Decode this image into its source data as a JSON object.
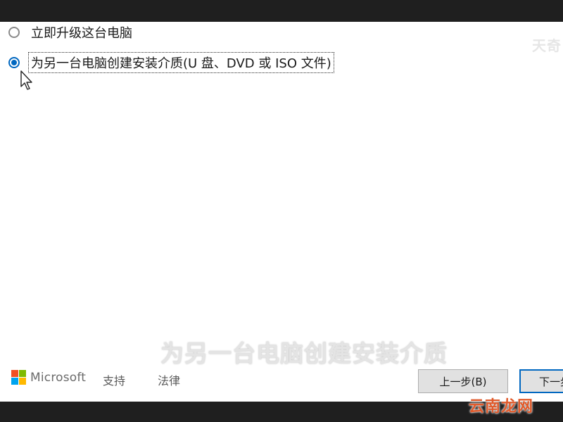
{
  "options": [
    {
      "label": "立即升级这台电脑",
      "selected": false
    },
    {
      "label": "为另一台电脑创建安装介质(U 盘、DVD 或 ISO 文件)",
      "selected": true
    }
  ],
  "footer": {
    "brand": "Microsoft",
    "links": {
      "support": "支持",
      "legal": "法律"
    },
    "buttons": {
      "back": "上一步(B)",
      "next": "下一步(N)"
    }
  },
  "overlays": {
    "subtitle": "为另一台电脑创建安装介质",
    "top_right_watermark": "天奇",
    "corner_watermark": "云南龙网"
  },
  "colors": {
    "accent": "#0067c0",
    "ms_red": "#f25022",
    "ms_green": "#7fba00",
    "ms_blue": "#00a4ef",
    "ms_yellow": "#ffb900"
  }
}
